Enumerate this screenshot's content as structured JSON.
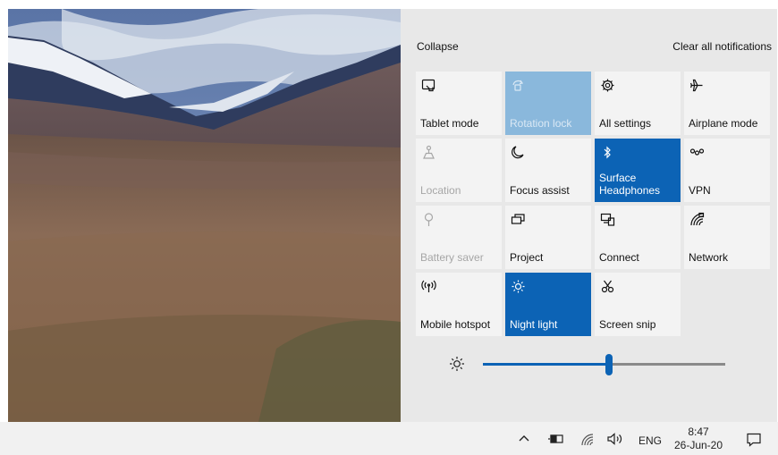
{
  "action_center": {
    "collapse_label": "Collapse",
    "clear_label": "Clear all notifications",
    "tiles": [
      {
        "label": "Tablet mode",
        "icon": "tablet-mode-icon",
        "state": "off"
      },
      {
        "label": "Rotation lock",
        "icon": "rotation-lock-icon",
        "state": "disabled-on"
      },
      {
        "label": "All settings",
        "icon": "gear-icon",
        "state": "off"
      },
      {
        "label": "Airplane mode",
        "icon": "airplane-icon",
        "state": "off"
      },
      {
        "label": "Location",
        "icon": "location-icon",
        "state": "disabled"
      },
      {
        "label": "Focus assist",
        "icon": "moon-icon",
        "state": "off"
      },
      {
        "label": "Surface\nHeadphones",
        "icon": "bluetooth-icon",
        "state": "on"
      },
      {
        "label": "VPN",
        "icon": "vpn-icon",
        "state": "off"
      },
      {
        "label": "Battery saver",
        "icon": "battery-saver-icon",
        "state": "disabled"
      },
      {
        "label": "Project",
        "icon": "project-icon",
        "state": "off"
      },
      {
        "label": "Connect",
        "icon": "connect-icon",
        "state": "off"
      },
      {
        "label": "Network",
        "icon": "network-icon",
        "state": "off"
      },
      {
        "label": "Mobile hotspot",
        "icon": "mobile-hotspot-icon",
        "state": "off"
      },
      {
        "label": "Night light",
        "icon": "night-light-icon",
        "state": "on"
      },
      {
        "label": "Screen snip",
        "icon": "screen-snip-icon",
        "state": "off"
      }
    ],
    "brightness_percent": 52
  },
  "taskbar": {
    "language": "ENG",
    "time": "8:47",
    "date": "26-Jun-20",
    "tray_icons": [
      "chevron-up-icon",
      "battery-icon",
      "wifi-icon",
      "volume-icon"
    ]
  },
  "colors": {
    "accent": "#0c63b5",
    "rotation_lock_tile": "#8ab8dc",
    "panel_bg": "#e8e8e8",
    "tile_bg": "#f3f3f3"
  }
}
